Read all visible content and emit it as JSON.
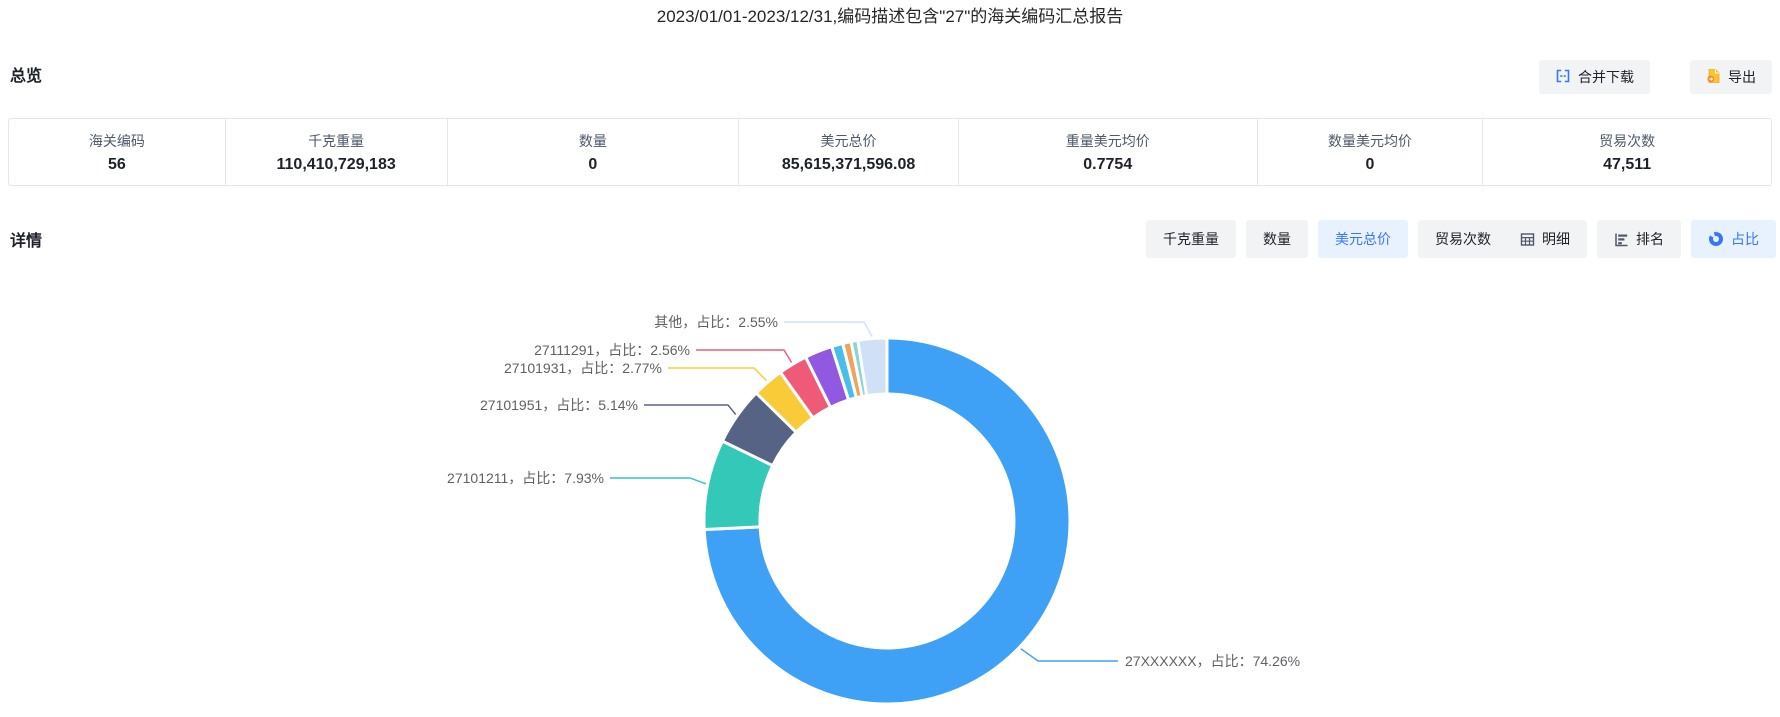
{
  "title": "2023/01/01-2023/12/31,编码描述包含\"27\"的海关编码汇总报告",
  "accent_color": "#3876f6",
  "overview": {
    "heading": "总览",
    "buttons": {
      "merge_download": "合并下载",
      "export": "导出"
    },
    "stats": [
      {
        "label": "海关编码",
        "value": "56"
      },
      {
        "label": "千克重量",
        "value": "110,410,729,183"
      },
      {
        "label": "数量",
        "value": "0"
      },
      {
        "label": "美元总价",
        "value": "85,615,371,596.08"
      },
      {
        "label": "重量美元均价",
        "value": "0.7754"
      },
      {
        "label": "数量美元均价",
        "value": "0"
      },
      {
        "label": "贸易次数",
        "value": "47,511"
      }
    ]
  },
  "detail": {
    "heading": "详情",
    "metric_tabs": [
      {
        "label": "千克重量",
        "active": false
      },
      {
        "label": "数量",
        "active": false
      },
      {
        "label": "美元总价",
        "active": true
      },
      {
        "label": "贸易次数",
        "active": false
      }
    ],
    "view_tabs": [
      {
        "label": "明细",
        "icon": "table-icon",
        "active": false
      },
      {
        "label": "排名",
        "icon": "ranking-icon",
        "active": false
      },
      {
        "label": "占比",
        "icon": "donut-icon",
        "active": true
      }
    ]
  },
  "chart_data": {
    "type": "pie",
    "subtype": "donut",
    "value_kind": "share-percent",
    "legend_position": "none",
    "segments": [
      {
        "name": "27XXXXXX",
        "value": 74.26,
        "color": "#3fa1f5",
        "label": "27XXXXXX，占比：74.26%"
      },
      {
        "name": "27101211",
        "value": 7.93,
        "color": "#33c8b7",
        "label": "27101211，占比：7.93%"
      },
      {
        "name": "27101951",
        "value": 5.14,
        "color": "#566385",
        "label": "27101951，占比：5.14%"
      },
      {
        "name": "27101931",
        "value": 2.77,
        "color": "#f9cb39",
        "label": "27101931，占比：2.77%"
      },
      {
        "name": "27111291",
        "value": 2.56,
        "color": "#ef5a78",
        "label": "27111291，占比：2.56%"
      },
      {
        "name": "unlabeled-small-1",
        "value": 2.45,
        "color": "#9158e2",
        "label": ""
      },
      {
        "name": "unlabeled-small-2",
        "value": 1.0,
        "color": "#49beeb",
        "label": ""
      },
      {
        "name": "unlabeled-small-3",
        "value": 0.75,
        "color": "#f0a35e",
        "label": ""
      },
      {
        "name": "unlabeled-small-4",
        "value": 0.59,
        "color": "#86d7cd",
        "label": ""
      },
      {
        "name": "其他",
        "value": 2.55,
        "color": "#cfe0f7",
        "label": "其他，占比：2.55%"
      }
    ]
  }
}
